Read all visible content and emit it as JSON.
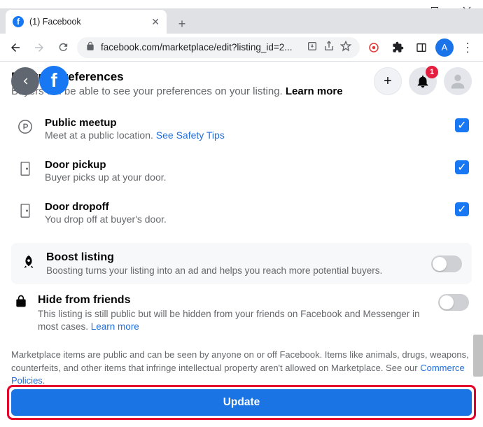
{
  "window": {
    "tab_title": "(1) Facebook",
    "url": "facebook.com/marketplace/edit?listing_id=2...",
    "avatar_letter": "A"
  },
  "fb_header": {
    "notif_count": "1"
  },
  "meetup": {
    "title": "Meetup preferences",
    "subtitle_pre": "Buyers will be able to see your preferences on your listing. ",
    "subtitle_link": "Learn more",
    "items": [
      {
        "title": "Public meetup",
        "desc_pre": "Meet at a public location. ",
        "desc_link": "See Safety Tips",
        "checked": true,
        "icon": "P"
      },
      {
        "title": "Door pickup",
        "desc_pre": "Buyer picks up at your door.",
        "desc_link": "",
        "checked": true,
        "icon": "door"
      },
      {
        "title": "Door dropoff",
        "desc_pre": "You drop off at buyer's door.",
        "desc_link": "",
        "checked": true,
        "icon": "door"
      }
    ]
  },
  "boost": {
    "title": "Boost listing",
    "desc": "Boosting turns your listing into an ad and helps you reach more potential buyers.",
    "on": false
  },
  "hide": {
    "title": "Hide from friends",
    "desc_pre": "This listing is still public but will be hidden from your friends on Facebook and Messenger in most cases. ",
    "desc_link": "Learn more",
    "on": false
  },
  "disclaimer": {
    "text_pre": "Marketplace items are public and can be seen by anyone on or off Facebook. Items like animals, drugs, weapons, counterfeits, and other items that infringe intellectual property aren't allowed on Marketplace. See our ",
    "link": "Commerce Policies",
    "text_post": "."
  },
  "update_label": "Update"
}
